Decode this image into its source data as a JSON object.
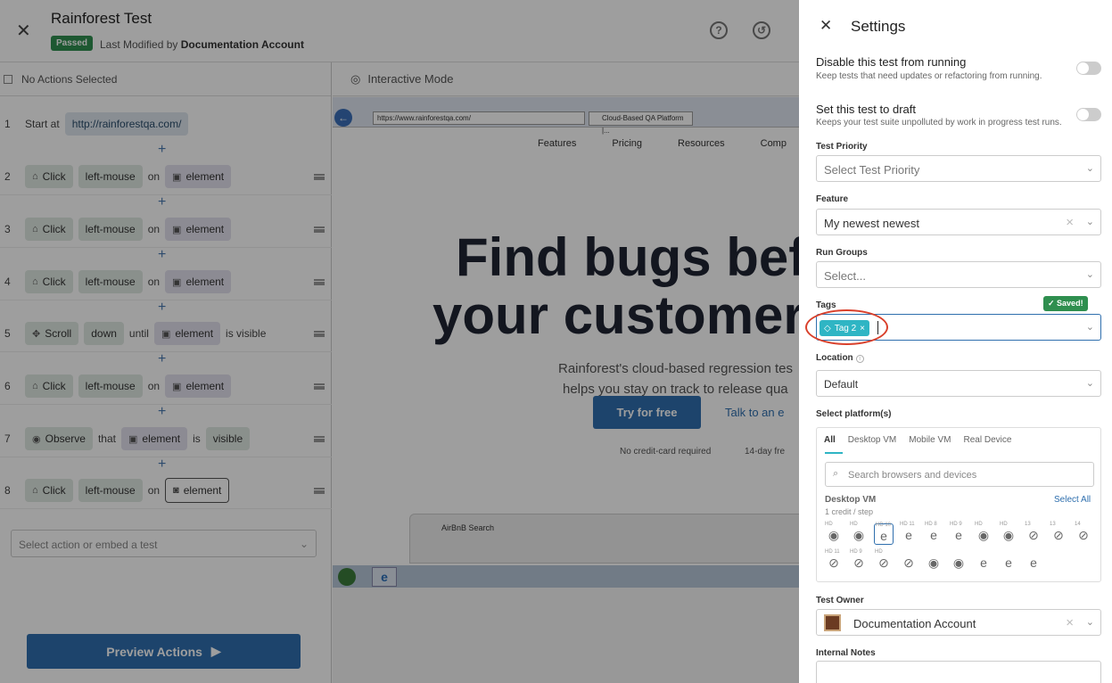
{
  "header": {
    "title": "Rainforest Test",
    "status": "Passed",
    "modified_prefix": "Last Modified by",
    "modified_by": "Documentation Account"
  },
  "steps_panel": {
    "header": "No Actions Selected",
    "select_placeholder": "Select action or embed a test",
    "preview_label": "Preview Actions"
  },
  "steps": [
    {
      "num": "1",
      "tokens": [
        {
          "t": "word",
          "v": "Start at"
        },
        {
          "t": "url",
          "v": "http://rainforestqa.com/"
        }
      ]
    },
    {
      "num": "2",
      "tokens": [
        {
          "t": "chip",
          "icon": "mouse",
          "v": "Click"
        },
        {
          "t": "chip",
          "v": "left-mouse"
        },
        {
          "t": "word",
          "v": "on"
        },
        {
          "t": "el",
          "v": "element"
        }
      ]
    },
    {
      "num": "3",
      "tokens": [
        {
          "t": "chip",
          "icon": "mouse",
          "v": "Click"
        },
        {
          "t": "chip",
          "v": "left-mouse"
        },
        {
          "t": "word",
          "v": "on"
        },
        {
          "t": "el",
          "v": "element"
        }
      ]
    },
    {
      "num": "4",
      "tokens": [
        {
          "t": "chip",
          "icon": "mouse",
          "v": "Click"
        },
        {
          "t": "chip",
          "v": "left-mouse"
        },
        {
          "t": "word",
          "v": "on"
        },
        {
          "t": "el",
          "v": "element"
        }
      ]
    },
    {
      "num": "5",
      "tokens": [
        {
          "t": "chip",
          "icon": "move",
          "v": "Scroll"
        },
        {
          "t": "chip",
          "v": "down"
        },
        {
          "t": "word",
          "v": "until"
        },
        {
          "t": "el",
          "v": "element"
        },
        {
          "t": "word",
          "v": "is visible"
        }
      ]
    },
    {
      "num": "6",
      "tokens": [
        {
          "t": "chip",
          "icon": "mouse",
          "v": "Click"
        },
        {
          "t": "chip",
          "v": "left-mouse"
        },
        {
          "t": "word",
          "v": "on"
        },
        {
          "t": "el",
          "v": "element"
        }
      ]
    },
    {
      "num": "7",
      "tokens": [
        {
          "t": "chip",
          "icon": "eye",
          "v": "Observe"
        },
        {
          "t": "word",
          "v": "that"
        },
        {
          "t": "el",
          "v": "element"
        },
        {
          "t": "word",
          "v": "is"
        },
        {
          "t": "chip",
          "v": "visible"
        }
      ]
    },
    {
      "num": "8",
      "tokens": [
        {
          "t": "chip",
          "icon": "mouse",
          "v": "Click"
        },
        {
          "t": "chip",
          "v": "left-mouse"
        },
        {
          "t": "word",
          "v": "on"
        },
        {
          "t": "elsel",
          "v": "element"
        }
      ]
    }
  ],
  "viewer": {
    "mode_label": "Interactive Mode",
    "address": "https://www.rainforestqa.com/",
    "tab": "Cloud-Based QA Platform |...",
    "nav": [
      "Features",
      "Pricing",
      "Resources",
      "Comp"
    ],
    "hero_line1": "Find bugs befo",
    "hero_line2": "your customers",
    "sub_line1": "Rainforest's cloud-based regression tes",
    "sub_line2": "helps you stay on track to release qua",
    "try_label": "Try for free",
    "talk_label": "Talk to an e",
    "no_cc": "No credit-card required",
    "trial": "14-day fre",
    "thumb_title": "AirBnB Search"
  },
  "settings": {
    "title": "Settings",
    "disable_title": "Disable this test from running",
    "disable_desc": "Keep tests that need updates or refactoring from running.",
    "draft_title": "Set this test to draft",
    "draft_desc": "Keeps your test suite unpolluted by work in progress test runs.",
    "priority_label": "Test Priority",
    "priority_placeholder": "Select Test Priority",
    "feature_label": "Feature",
    "feature_value": "My newest newest",
    "run_groups_label": "Run Groups",
    "run_groups_placeholder": "Select...",
    "tags_label": "Tags",
    "saved_label": "Saved!",
    "tag_value": "Tag 2",
    "location_label": "Location",
    "location_value": "Default",
    "platforms_label": "Select platform(s)",
    "platform_tabs": [
      "All",
      "Desktop VM",
      "Mobile VM",
      "Real Device"
    ],
    "platform_search_placeholder": "Search browsers and devices",
    "platform_group": "Desktop VM",
    "platform_credit": "1 credit / step",
    "select_all": "Select All",
    "owner_label": "Test Owner",
    "owner_value": "Documentation Account",
    "notes_label": "Internal Notes"
  },
  "browsers": [
    {
      "glyph": "◉",
      "badge": "HD"
    },
    {
      "glyph": "◉",
      "badge": "HD"
    },
    {
      "glyph": "e",
      "badge": "HD 10",
      "selected": true
    },
    {
      "glyph": "e",
      "badge": "HD 11"
    },
    {
      "glyph": "e",
      "badge": "HD 8"
    },
    {
      "glyph": "e",
      "badge": "HD 9"
    },
    {
      "glyph": "◉",
      "badge": "HD"
    },
    {
      "glyph": "◉",
      "badge": "HD"
    },
    {
      "glyph": "⊘",
      "badge": "13"
    },
    {
      "glyph": "⊘",
      "badge": "13"
    },
    {
      "glyph": "⊘",
      "badge": "14"
    },
    {
      "glyph": "⊘",
      "badge": "HD 11"
    },
    {
      "glyph": "⊘",
      "badge": "HD 9"
    },
    {
      "glyph": "⊘",
      "badge": "HD"
    },
    {
      "glyph": "⊘",
      "badge": ""
    },
    {
      "glyph": "◉",
      "badge": ""
    },
    {
      "glyph": "◉",
      "badge": ""
    },
    {
      "glyph": "e",
      "badge": ""
    },
    {
      "glyph": "e",
      "badge": ""
    },
    {
      "glyph": "e",
      "badge": ""
    }
  ]
}
